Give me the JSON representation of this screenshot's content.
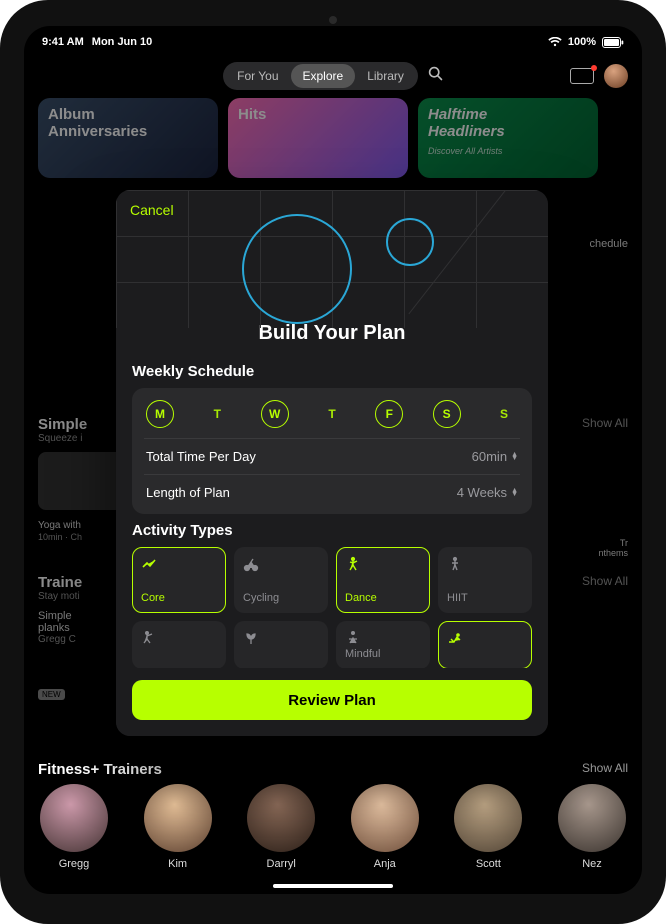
{
  "status": {
    "time": "9:41 AM",
    "date": "Mon Jun 10",
    "battery": "100%"
  },
  "nav": {
    "tabs": {
      "for_you": "For You",
      "explore": "Explore",
      "library": "Library"
    },
    "cast_icon": "airplay-icon",
    "avatar": "profile-avatar",
    "search": "search-icon"
  },
  "bg_cards": {
    "c1a": "Album",
    "c1b": "Anniversaries",
    "c2": "Hits",
    "c3a": "Halftime",
    "c3b": "Headliners",
    "c3c": "Discover All Artists"
  },
  "bg": {
    "simple_title": "Simple",
    "simple_sub": "Squeeze i",
    "yoga_line1": "Yoga with",
    "yoga_line2": "10min · Ch",
    "traine_title": "Traine",
    "traine_sub": "Stay moti",
    "card_a": "Simple",
    "card_b": "planks",
    "card_c": "Gregg C",
    "new": "NEW",
    "schedule": "chedule",
    "tr_right": "Tr",
    "nthems": "nthems",
    "showall": "Show All"
  },
  "trainers": {
    "title": "Fitness+ Trainers",
    "showall": "Show All",
    "items": [
      {
        "name": "Gregg"
      },
      {
        "name": "Kim"
      },
      {
        "name": "Darryl"
      },
      {
        "name": "Anja"
      },
      {
        "name": "Scott"
      },
      {
        "name": "Nez"
      }
    ]
  },
  "sheet": {
    "cancel": "Cancel",
    "title": "Build Your Plan",
    "weekly_label": "Weekly Schedule",
    "days": [
      {
        "letter": "M",
        "on": true
      },
      {
        "letter": "T",
        "on": false
      },
      {
        "letter": "W",
        "on": true
      },
      {
        "letter": "T",
        "on": false
      },
      {
        "letter": "F",
        "on": true
      },
      {
        "letter": "S",
        "on": true
      },
      {
        "letter": "S",
        "on": false
      }
    ],
    "settings": {
      "total_label": "Total Time Per Day",
      "total_value": "60min",
      "length_label": "Length of Plan",
      "length_value": "4 Weeks"
    },
    "activity_label": "Activity Types",
    "activities_row1": [
      {
        "name": "Core",
        "sel": true
      },
      {
        "name": "Cycling",
        "sel": false
      },
      {
        "name": "Dance",
        "sel": true
      },
      {
        "name": "HIIT",
        "sel": false
      }
    ],
    "activities_row2": [
      {
        "name": "",
        "sel": false
      },
      {
        "name": "",
        "sel": false
      },
      {
        "name": "Mindful",
        "sel": false
      },
      {
        "name": "",
        "sel": true
      }
    ],
    "review": "Review Plan"
  }
}
